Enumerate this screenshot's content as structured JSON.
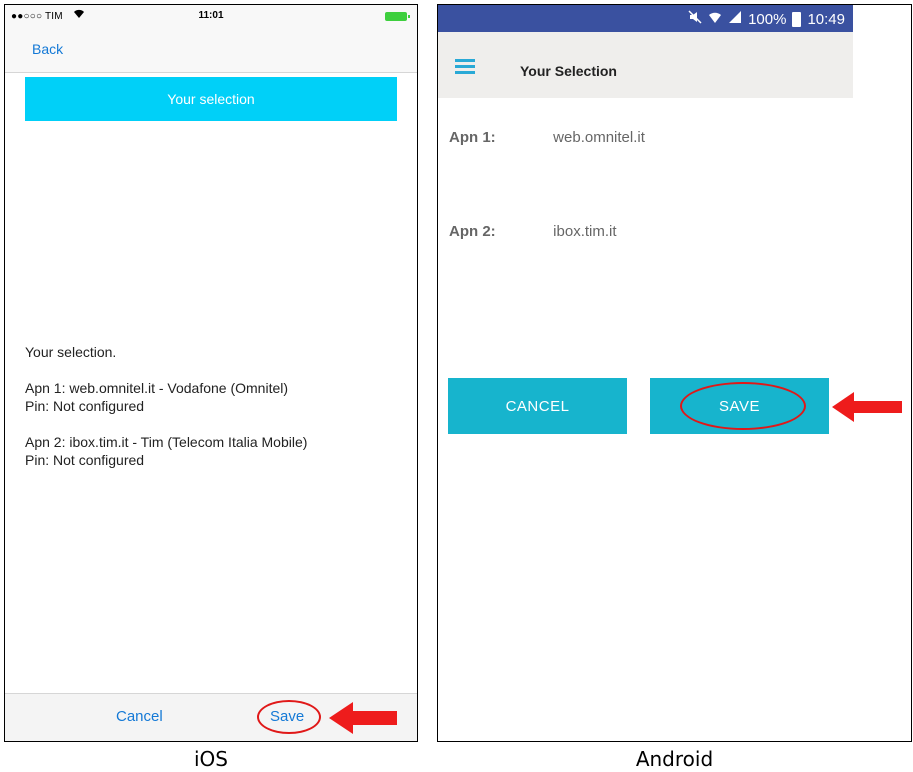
{
  "ios": {
    "status": {
      "carrier": "●●○○○ TIM",
      "time": "11:01"
    },
    "nav": {
      "back_label": "Back"
    },
    "banner_label": "Your selection",
    "body": {
      "intro": "Your selection.",
      "apn1": "Apn 1: web.omnitel.it - Vodafone (Omnitel)",
      "pin1": "Pin: Not configured",
      "apn2": "Apn 2: ibox.tim.it - Tim (Telecom Italia Mobile)",
      "pin2": "Pin: Not configured"
    },
    "toolbar": {
      "cancel_label": "Cancel",
      "save_label": "Save"
    }
  },
  "android": {
    "status": {
      "battery": "100%",
      "time": "10:49"
    },
    "toolbar": {
      "title": "Your Selection"
    },
    "rows": [
      {
        "label": "Apn 1:",
        "value": "web.omnitel.it"
      },
      {
        "label": "Apn 2:",
        "value": "ibox.tim.it"
      }
    ],
    "buttons": {
      "cancel_label": "CANCEL",
      "save_label": "SAVE"
    }
  },
  "captions": {
    "ios": "iOS",
    "android": "Android"
  },
  "colors": {
    "ios_accent": "#1479d6",
    "ios_banner": "#00d0f8",
    "android_status": "#3a51a0",
    "android_button": "#17b4cd",
    "highlight": "#e01818"
  }
}
